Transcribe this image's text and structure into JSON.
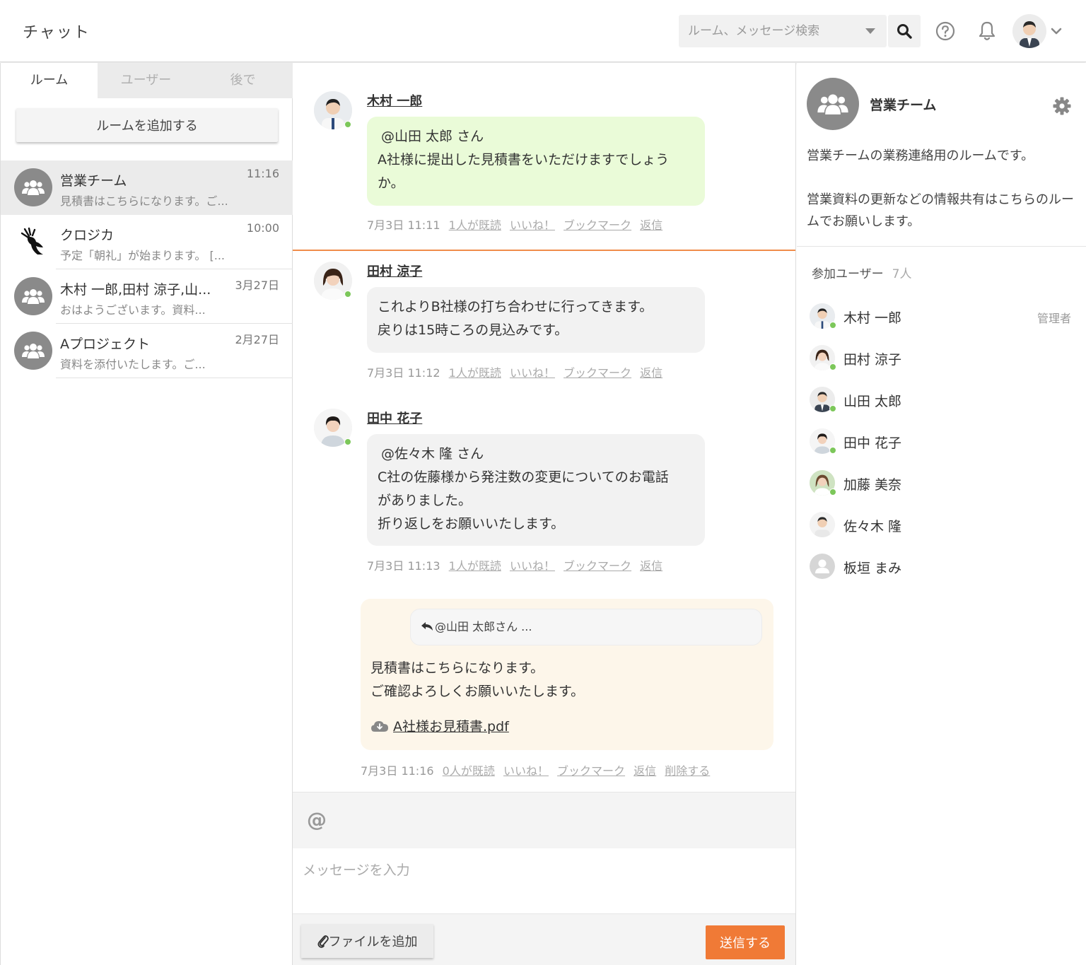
{
  "header": {
    "app_title": "チャット",
    "search_placeholder": "ルーム、メッセージ検索"
  },
  "left": {
    "tabs": [
      "ルーム",
      "ユーザー",
      "後で"
    ],
    "add_room_label": "ルームを追加する",
    "rooms": [
      {
        "name": "営業チーム",
        "preview": "見積書はこちらになります。ご...",
        "time": "11:16"
      },
      {
        "name": "クロジカ",
        "preview": "予定「朝礼」が始まります。 [...",
        "time": "10:00"
      },
      {
        "name": "木村 一郎,田村 涼子,山...",
        "preview": "おはようございます。資料...",
        "time": "3月27日"
      },
      {
        "name": "Aプロジェクト",
        "preview": "資料を添付いたします。ご...",
        "time": "2月27日"
      }
    ]
  },
  "messages": [
    {
      "author": "木村 一郎",
      "mention": "@山田 太郎 さん",
      "body": "A社様に提出した見積書をいただけますでしょうか。",
      "timestamp": "7月3日 11:11",
      "read": "1人が既読",
      "like": "いいね！",
      "bookmark": "ブックマーク",
      "reply": "返信"
    },
    {
      "author": "田村 涼子",
      "body_lines": [
        "これよりB社様の打ち合わせに行ってきます。",
        "戻りは15時ころの見込みです。"
      ],
      "timestamp": "7月3日 11:12",
      "read": "1人が既読",
      "like": "いいね！",
      "bookmark": "ブックマーク",
      "reply": "返信"
    },
    {
      "author": "田中 花子",
      "mention": "@佐々木 隆 さん",
      "body_lines": [
        "C社の佐藤様から発注数の変更についてのお電話",
        "がありました。",
        "折り返しをお願いいたします。"
      ],
      "timestamp": "7月3日 11:13",
      "read": "1人が既読",
      "like": "いいね！",
      "bookmark": "ブックマーク",
      "reply": "返信"
    }
  ],
  "own_message": {
    "quote": "@山田 太郎さん ...",
    "body_lines": [
      "見積書はこちらになります。",
      "ご確認よろしくお願いいたします。"
    ],
    "attachment": "A社様お見積書.pdf",
    "timestamp": "7月3日 11:16",
    "read": "0人が既読",
    "like": "いいね！",
    "bookmark": "ブックマーク",
    "reply": "返信",
    "delete": "削除する"
  },
  "composer": {
    "mention_symbol": "@",
    "placeholder": "メッセージを入力",
    "file_button": "ファイルを追加",
    "send_button": "送信する"
  },
  "room_info": {
    "title": "営業チーム",
    "description": "営業チームの業務連絡用のルームです。\n\n営業資料の更新などの情報共有はこちらのルームでお願いします。",
    "members_label": "参加ユーザー",
    "members_count": "7人",
    "members": [
      {
        "name": "木村 一郎",
        "role": "管理者"
      },
      {
        "name": "田村 涼子",
        "role": ""
      },
      {
        "name": "山田 太郎",
        "role": ""
      },
      {
        "name": "田中 花子",
        "role": ""
      },
      {
        "name": "加藤 美奈",
        "role": ""
      },
      {
        "name": "佐々木 隆",
        "role": ""
      },
      {
        "name": "板垣 まみ",
        "role": ""
      }
    ]
  },
  "colors": {
    "accent": "#f07a36",
    "online": "#7cc75a",
    "own_bubble": "#fdf6ea",
    "mention_bubble": "#eafbd8"
  }
}
